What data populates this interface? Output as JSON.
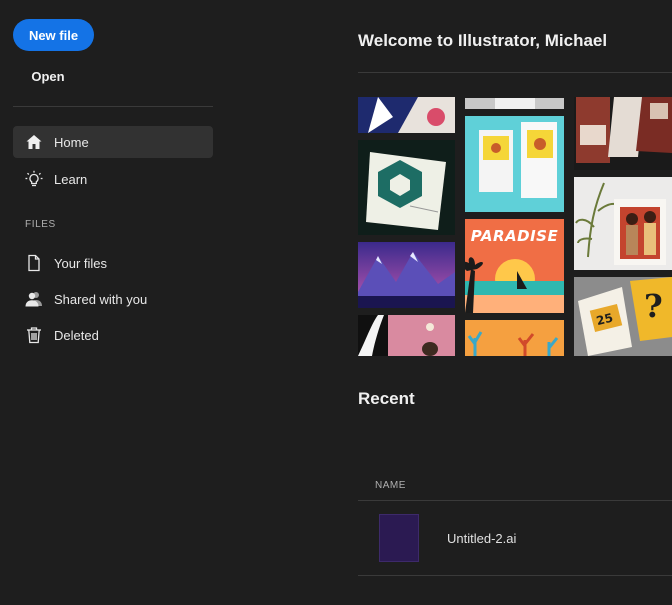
{
  "sidebar": {
    "new_file_label": "New file",
    "open_label": "Open",
    "nav": [
      {
        "label": "Home",
        "icon": "home-icon",
        "active": true
      },
      {
        "label": "Learn",
        "icon": "lightbulb-icon",
        "active": false
      }
    ],
    "files_section_label": "FILES",
    "files": [
      {
        "label": "Your files",
        "icon": "file-icon"
      },
      {
        "label": "Shared with you",
        "icon": "shared-users-icon"
      },
      {
        "label": "Deleted",
        "icon": "trash-icon"
      }
    ]
  },
  "main": {
    "welcome": "Welcome to Illustrator, Michael",
    "banner": {
      "poster_text": "PARADISE"
    },
    "recent_title": "Recent",
    "recent_table": {
      "columns": [
        "NAME"
      ],
      "rows": [
        {
          "name": "Untitled-2.ai",
          "thumb_color": "#2b1a52"
        }
      ]
    }
  },
  "colors": {
    "background": "#1e1e1e",
    "accent": "#1473e6",
    "active_item": "#323232",
    "divider": "#3a3a3a"
  }
}
